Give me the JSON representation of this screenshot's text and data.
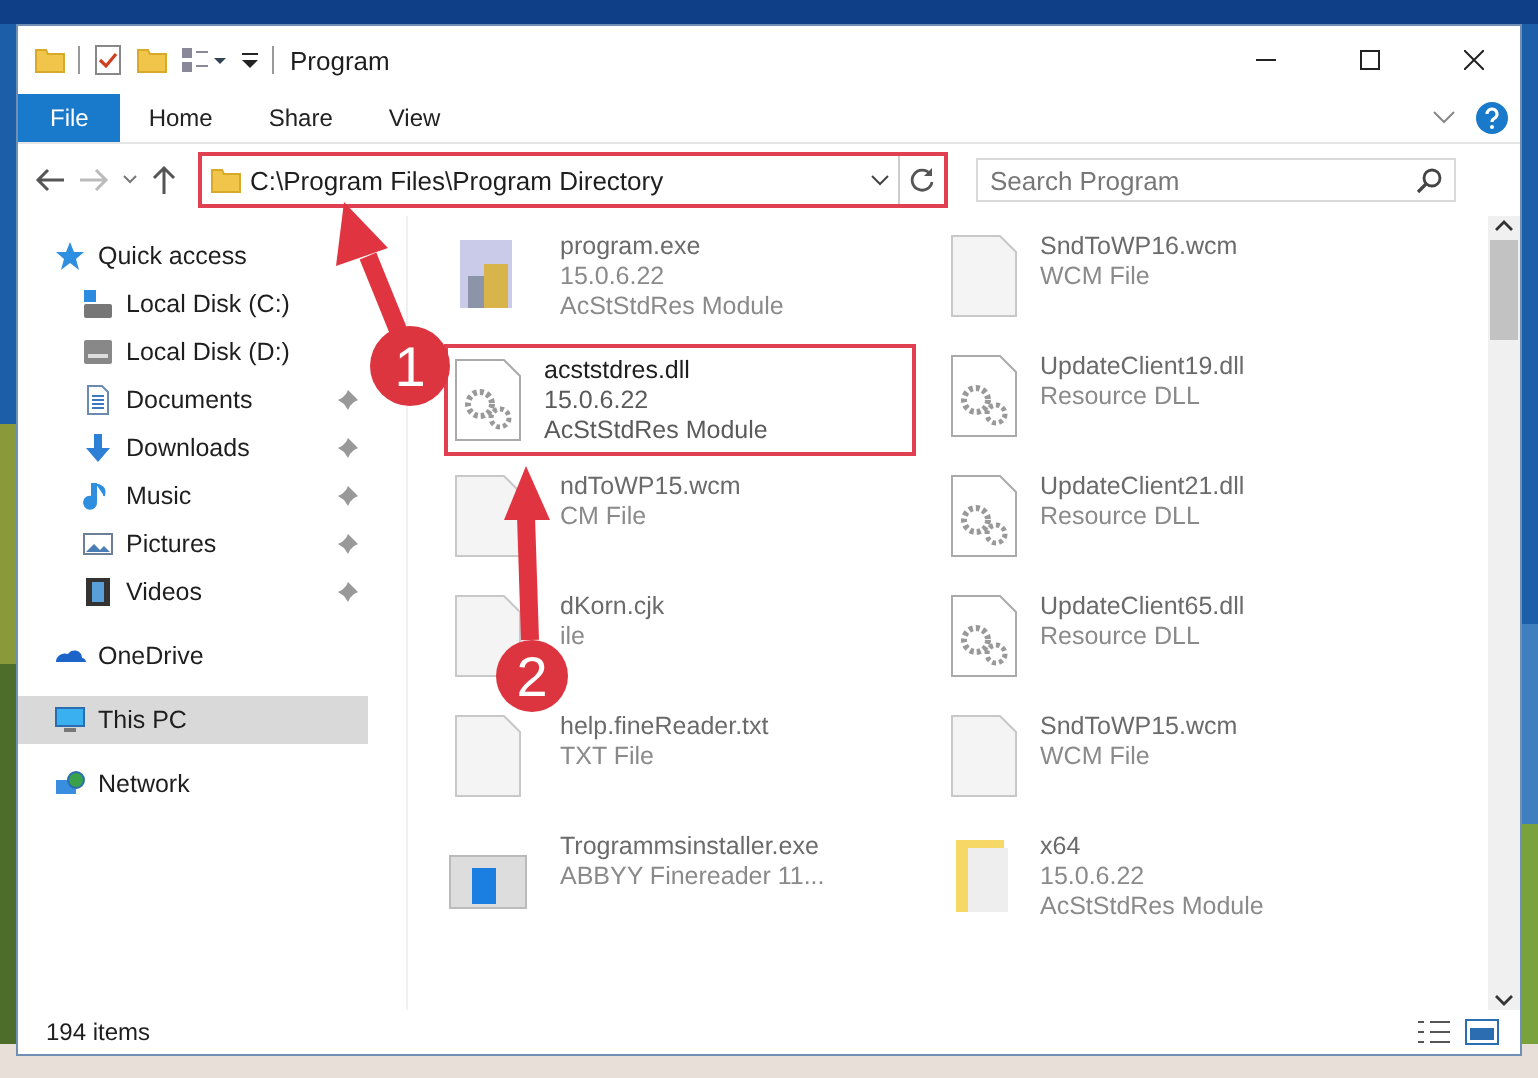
{
  "window": {
    "title": "Program"
  },
  "ribbon": {
    "tabs": [
      {
        "label": "File",
        "kind": "file"
      },
      {
        "label": "Home",
        "kind": "tab"
      },
      {
        "label": "Share",
        "kind": "tab"
      },
      {
        "label": "View",
        "kind": "tab"
      }
    ]
  },
  "address": {
    "path": "C:\\Program Files\\Program Directory",
    "highlighted": true
  },
  "search": {
    "placeholder": "Search Program"
  },
  "sidebar": {
    "items": [
      {
        "label": "Quick access",
        "selected": false,
        "children": [
          {
            "label": "Local Disk (C:)",
            "pinned": false,
            "selected": false
          },
          {
            "label": "Local Disk (D:)",
            "pinned": false,
            "selected": false
          },
          {
            "label": "Documents",
            "pinned": true,
            "selected": false
          },
          {
            "label": "Downloads",
            "pinned": true,
            "selected": false
          },
          {
            "label": "Music",
            "pinned": true,
            "selected": false
          },
          {
            "label": "Pictures",
            "pinned": true,
            "selected": false
          },
          {
            "label": "Videos",
            "pinned": true,
            "selected": false
          }
        ]
      },
      {
        "label": "OneDrive",
        "selected": false
      },
      {
        "label": "This PC",
        "selected": true
      },
      {
        "label": "Network",
        "selected": false
      }
    ]
  },
  "files": [
    {
      "name": "program.exe",
      "details": [
        "15.0.6.22",
        "AcStStdRes Module"
      ],
      "kind": "exe",
      "highlighted": false
    },
    {
      "name": "SndToWP16.wcm",
      "details": [
        "WCM File"
      ],
      "kind": "blank",
      "highlighted": false
    },
    {
      "name": "acststdres.dll",
      "details": [
        "15.0.6.22",
        "AcStStdRes Module"
      ],
      "kind": "dll",
      "highlighted": true
    },
    {
      "name": "UpdateClient19.dll",
      "details": [
        "Resource DLL"
      ],
      "kind": "dll",
      "highlighted": false
    },
    {
      "name": "ndToWP15.wcm",
      "details": [
        "CM File"
      ],
      "kind": "blank",
      "highlighted": false
    },
    {
      "name": "UpdateClient21.dll",
      "details": [
        "Resource DLL"
      ],
      "kind": "dll",
      "highlighted": false
    },
    {
      "name": "dKorn.cjk",
      "details": [
        "ile"
      ],
      "kind": "blank",
      "highlighted": false
    },
    {
      "name": "UpdateClient65.dll",
      "details": [
        "Resource DLL"
      ],
      "kind": "dll",
      "highlighted": false
    },
    {
      "name": "help.fineReader.txt",
      "details": [
        "TXT File"
      ],
      "kind": "blank",
      "highlighted": false
    },
    {
      "name": "SndToWP15.wcm",
      "details": [
        "WCM File"
      ],
      "kind": "blank",
      "highlighted": false
    },
    {
      "name": "Trogrammsinstaller.exe",
      "details": [
        "ABBYY Finereader 11..."
      ],
      "kind": "installer",
      "highlighted": false
    },
    {
      "name": "x64",
      "details": [
        "15.0.6.22",
        "AcStStdRes Module"
      ],
      "kind": "folder",
      "highlighted": false
    }
  ],
  "status_bar": {
    "text": "194 items"
  },
  "annotations": [
    {
      "number": "1"
    },
    {
      "number": "2"
    }
  ]
}
